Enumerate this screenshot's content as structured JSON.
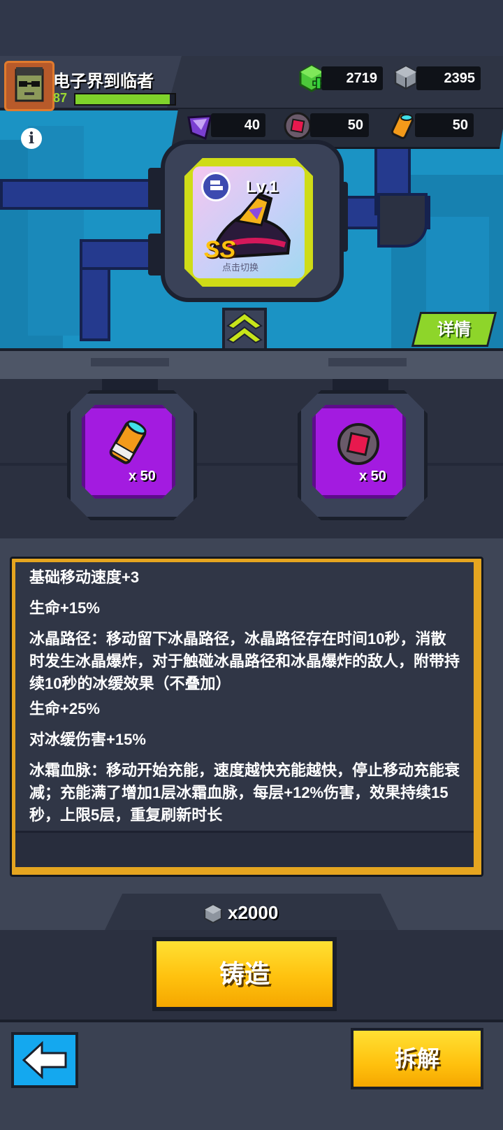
{
  "player": {
    "name": "电子界到临者",
    "level": "87",
    "xp_fraction": 0.95
  },
  "currencies": {
    "gems": "2719",
    "ore": "2395"
  },
  "materials": [
    {
      "icon": "purple-crystal-icon",
      "count": "40"
    },
    {
      "icon": "red-core-icon",
      "count": "50"
    },
    {
      "icon": "orange-cylinder-icon",
      "count": "50"
    }
  ],
  "item": {
    "level": "Lv.1",
    "grade": "SS",
    "switch_hint": "点击切换"
  },
  "details_label": "详情",
  "slots": [
    {
      "icon": "orange-cylinder-icon",
      "count": "x 50"
    },
    {
      "icon": "red-core-icon",
      "count": "x 50"
    }
  ],
  "stats": [
    "基础移动速度+3",
    "生命+15%",
    "冰晶路径：移动留下冰晶路径，冰晶路径存在时间10秒，消散时发生冰晶爆炸，对于触碰冰晶路径和冰晶爆炸的敌人，附带持续10秒的冰缓效果（不叠加）",
    "生命+25%",
    "对冰缓伤害+15%",
    "冰霜血脉：移动开始充能，速度越快充能越快，停止移动充能衰减；充能满了增加1层冰霜血脉，每层+12%伤害，效果持续15秒，上限5层，重复刷新时长"
  ],
  "cost": "x2000",
  "forge_label": "铸造",
  "dismantle_label": "拆解",
  "colors": {
    "accent_yellow": "#ffc10e",
    "accent_green": "#8ed52a",
    "slot_purple": "#a31be0",
    "frame_lime": "#cfdc17"
  }
}
